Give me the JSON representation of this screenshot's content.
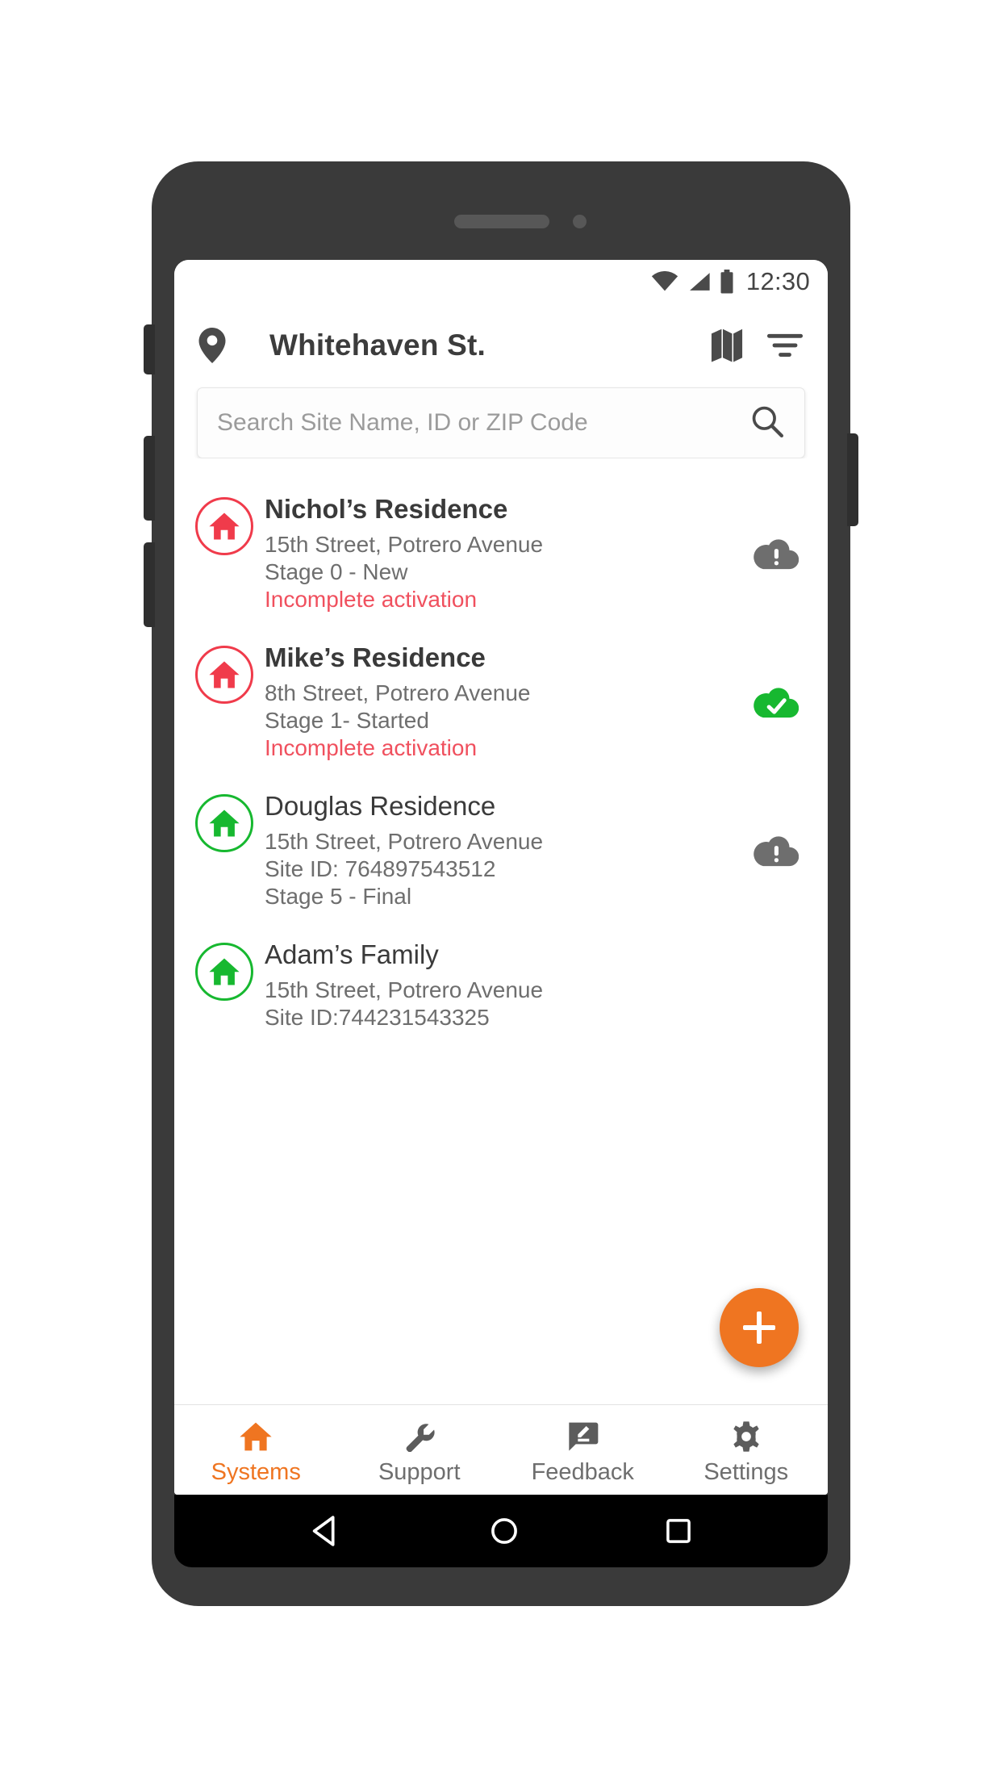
{
  "status_bar": {
    "time": "12:30",
    "icons": [
      "wifi-icon",
      "cellular-signal-icon",
      "battery-icon"
    ]
  },
  "app_bar": {
    "location_icon": "location-pin-icon",
    "title": "Whitehaven St.",
    "map_icon": "map-icon",
    "filter_icon": "filter-icon"
  },
  "search": {
    "placeholder": "Search Site Name, ID or ZIP Code",
    "value": "",
    "icon": "search-icon"
  },
  "sites": [
    {
      "name": "Nichol’s Residence",
      "bold": true,
      "badge_color": "#f03b4b",
      "lines": [
        "15th Street, Potrero Avenue",
        "Stage 0 - New"
      ],
      "alert_text": "Incomplete activation",
      "status_icon": "cloud-alert-icon",
      "status_color": "#6e6e6e"
    },
    {
      "name": "Mike’s Residence",
      "bold": true,
      "badge_color": "#f03b4b",
      "lines": [
        "8th Street, Potrero Avenue",
        "Stage 1- Started"
      ],
      "alert_text": "Incomplete activation",
      "status_icon": "cloud-check-icon",
      "status_color": "#17b830"
    },
    {
      "name": "Douglas Residence",
      "bold": false,
      "badge_color": "#17b830",
      "lines": [
        "15th Street, Potrero Avenue",
        "Site ID: 764897543512",
        "Stage 5 - Final"
      ],
      "alert_text": "",
      "status_icon": "cloud-alert-icon",
      "status_color": "#6e6e6e"
    },
    {
      "name": "Adam’s Family",
      "bold": false,
      "badge_color": "#17b830",
      "lines": [
        "15th Street, Potrero Avenue",
        "Site ID:744231543325"
      ],
      "alert_text": "",
      "status_icon": "",
      "status_color": ""
    }
  ],
  "fab": {
    "label": "+",
    "icon": "plus-icon",
    "color": "#ef7521"
  },
  "tabs": [
    {
      "label": "Systems",
      "icon": "home-icon",
      "active": true
    },
    {
      "label": "Support",
      "icon": "wrench-icon",
      "active": false
    },
    {
      "label": "Feedback",
      "icon": "feedback-icon",
      "active": false
    },
    {
      "label": "Settings",
      "icon": "gear-icon",
      "active": false
    }
  ],
  "android_nav": {
    "back": "back-triangle-icon",
    "home": "home-circle-icon",
    "recents": "recents-square-icon"
  },
  "colors": {
    "accent": "#ef7521",
    "alert": "#f0505e",
    "red": "#f03b4b",
    "green": "#17b830",
    "text": "#3a3a3a",
    "muted": "#6e6e6e"
  }
}
